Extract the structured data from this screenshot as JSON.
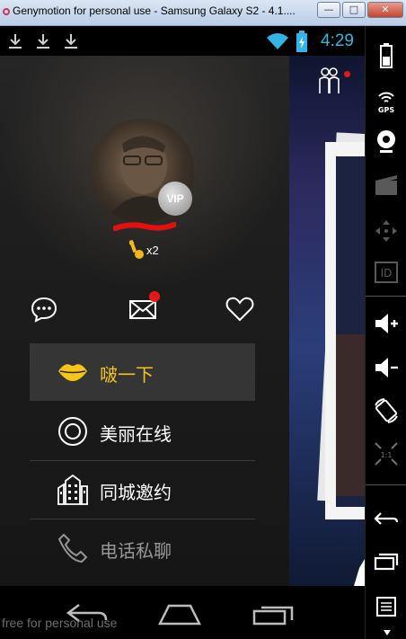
{
  "window": {
    "title": "Genymotion for personal use - Samsung Galaxy S2 - 4.1...."
  },
  "statusbar": {
    "time": "4:29"
  },
  "profile": {
    "vip_label": "VIP",
    "key_count": "x2"
  },
  "menu": {
    "items": [
      {
        "label": "啵一下",
        "icon": "lips-icon",
        "color": "#f5c518"
      },
      {
        "label": "美丽在线",
        "icon": "circle-target-icon",
        "color": "#ffffff"
      },
      {
        "label": "同城邀约",
        "icon": "city-buildings-icon",
        "color": "#ffffff"
      },
      {
        "label": "电话私聊",
        "icon": "phone-icon",
        "color": "#ffffff"
      }
    ]
  },
  "watermark": "free for personal use",
  "colors": {
    "accent": "#f5c518",
    "badge": "#e61818",
    "clock": "#33b5e5"
  }
}
